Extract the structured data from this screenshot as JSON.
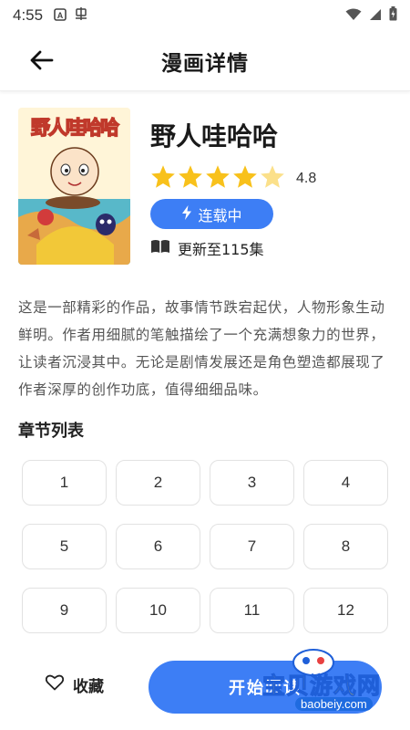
{
  "status_bar": {
    "time": "4:55",
    "icons_left": [
      "a-box-icon",
      "bug-icon"
    ],
    "icons_right": [
      "wifi-icon",
      "signal-icon",
      "battery-icon"
    ]
  },
  "header": {
    "title": "漫画详情",
    "back_icon": "arrow-left-icon"
  },
  "comic": {
    "cover_text": "野人哇哈哈",
    "title": "野人哇哈哈",
    "rating": "4.8",
    "rating_value": 4.8,
    "status": "连载中",
    "update": "更新至115集",
    "description": "这是一部精彩的作品，故事情节跌宕起伏，人物形象生动鲜明。作者用细腻的笔触描绘了一个充满想象力的世界，让读者沉浸其中。无论是剧情发展还是角色塑造都展现了作者深厚的创作功底，值得细细品味。"
  },
  "chapters": {
    "title": "章节列表",
    "items": [
      "1",
      "2",
      "3",
      "4",
      "5",
      "6",
      "7",
      "8",
      "9",
      "10",
      "11",
      "12"
    ]
  },
  "bottom": {
    "favorite_label": "收藏",
    "read_label": "开始阅读"
  },
  "watermark": {
    "text": "宝贝游戏网",
    "url": "baobeiy.com"
  },
  "colors": {
    "accent": "#3d7ef5",
    "star": "#f8c11b",
    "star_empty": "#fbe08a"
  }
}
